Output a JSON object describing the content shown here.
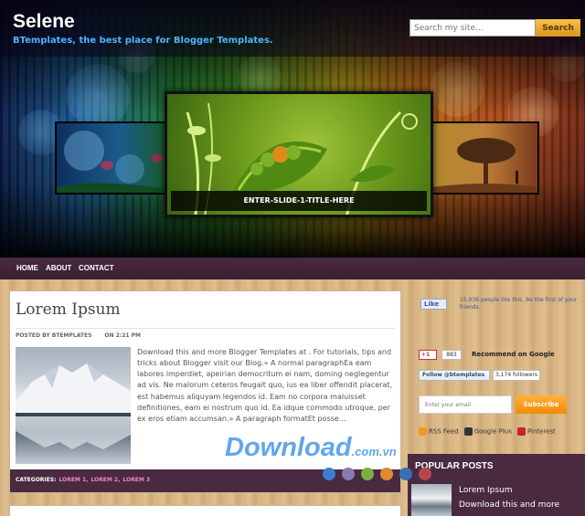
{
  "site": {
    "title": "Selene",
    "description": "BTemplates, the best place for Blogger Templates."
  },
  "search": {
    "placeholder": "Search my site...",
    "button_label": "Search"
  },
  "slider": {
    "caption": "ENTER-SLIDE-1-TITLE-HERE"
  },
  "nav": {
    "items": [
      "HOME",
      "ABOUT",
      "CONTACT"
    ]
  },
  "post": {
    "title": "Lorem Ipsum",
    "author_prefix": "POSTED BY BTEMPLATES",
    "time": "ON 2:21 PM",
    "body": "Download this and more Blogger Templates at . For tutorials, tips and tricks about Blogger visit our Blog.» A normal paragraphEa eam labores imperdiet, apeirian democritum ei nam, doming neglegentur ad vis. Ne malorum ceteros feugait quo, ius ea liber offendit placerat, est habemus aliquyam legendos id. Eam no corpora maluisset definitiones, eam ei nostrum quo id. Ea idque commodo utroque, per ex eros etiam accumsan.» A paragraph formatEt posse...",
    "categories_label": "CATEGORIES:",
    "categories": [
      "LOREM 1,",
      "LOREM 2,",
      "LOREM 3"
    ]
  },
  "sidebar": {
    "facebook": {
      "like_label": "Like",
      "like_text": "15,936 people like this. Be the first of your friends."
    },
    "google": {
      "plus_label": "+1",
      "count": "883",
      "recommend_text": "Recommend on Google"
    },
    "twitter": {
      "follow_label": "Follow @btemplates",
      "followers": "3,174 followers"
    },
    "subscribe": {
      "email_placeholder": "Enter your email",
      "button_label": "Subscribe"
    },
    "social_links": [
      "RSS Feed",
      "Google Plus",
      "Pinterest"
    ],
    "popular": {
      "heading": "POPULAR POSTS",
      "item_title": "Lorem Ipsum",
      "item_excerpt": "Download this and more"
    }
  },
  "watermark": {
    "brand": "Download",
    "tld": ".com.vn"
  },
  "colors": {
    "nav_bg": "#3a1f32",
    "accent_search": "#d8961e",
    "category_link": "#f08ab8",
    "site_desc": "#4fb3ff"
  }
}
